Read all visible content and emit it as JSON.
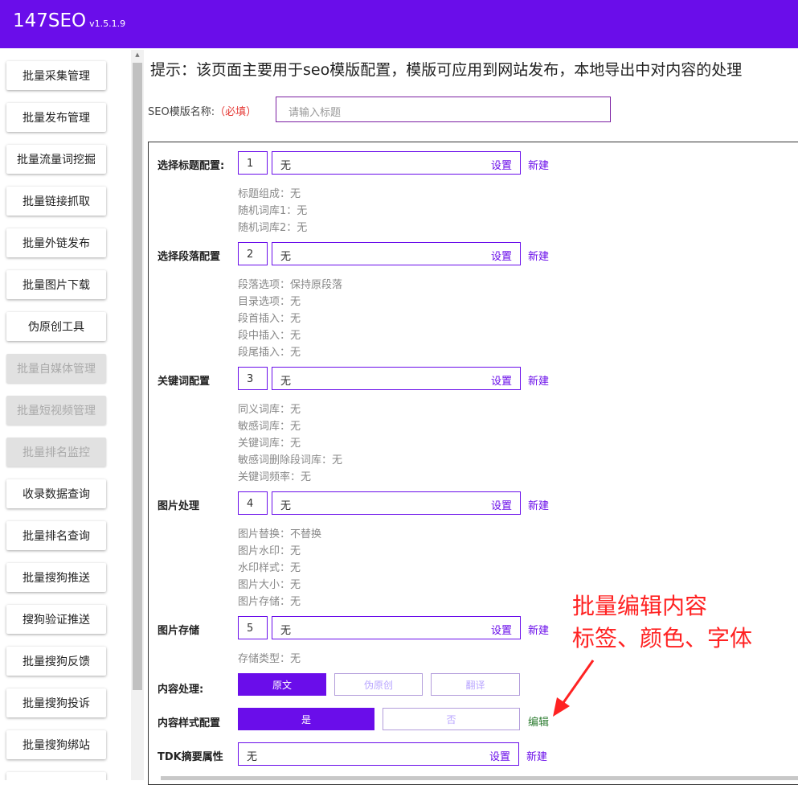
{
  "app": {
    "title": "147SEO",
    "version": "v1.5.1.9"
  },
  "sidebar": {
    "items": [
      {
        "label": "批量采集管理",
        "disabled": false
      },
      {
        "label": "批量发布管理",
        "disabled": false
      },
      {
        "label": "批量流量词挖掘",
        "disabled": false
      },
      {
        "label": "批量链接抓取",
        "disabled": false
      },
      {
        "label": "批量外链发布",
        "disabled": false
      },
      {
        "label": "批量图片下载",
        "disabled": false
      },
      {
        "label": "伪原创工具",
        "disabled": false
      },
      {
        "label": "批量自媒体管理",
        "disabled": true
      },
      {
        "label": "批量短视频管理",
        "disabled": true
      },
      {
        "label": "批量排名监控",
        "disabled": true
      },
      {
        "label": "收录数据查询",
        "disabled": false
      },
      {
        "label": "批量排名查询",
        "disabled": false
      },
      {
        "label": "批量搜狗推送",
        "disabled": false
      },
      {
        "label": "搜狗验证推送",
        "disabled": false
      },
      {
        "label": "批量搜狗反馈",
        "disabled": false
      },
      {
        "label": "批量搜狗投诉",
        "disabled": false
      },
      {
        "label": "批量搜狗绑站",
        "disabled": false
      }
    ]
  },
  "notice": "提示：该页面主要用于seo模版配置，模版可应用到网站发布，本地导出中对内容的处理",
  "template_name": {
    "label": "SEO模版名称:",
    "required": "（必填）",
    "placeholder": "请输入标题"
  },
  "config": {
    "set_label": "设置",
    "new_label": "新建",
    "rows": [
      {
        "label": "选择标题配置:",
        "number": "1",
        "value": "无",
        "details": [
          "标题组成：无",
          "随机词库1：无",
          "随机词库2：无"
        ]
      },
      {
        "label": "选择段落配置",
        "number": "2",
        "value": "无",
        "details": [
          "段落选项：保持原段落",
          "目录选项：无",
          "段首插入：无",
          "段中插入：无",
          "段尾插入：无"
        ]
      },
      {
        "label": "关键词配置",
        "number": "3",
        "value": "无",
        "details": [
          "同义词库：无",
          "敏感词库：无",
          "关键词库：无",
          "敏感词删除段词库：无",
          "关键词频率：无"
        ]
      },
      {
        "label": "图片处理",
        "number": "4",
        "value": "无",
        "details": [
          "图片替换：不替换",
          "图片水印：无",
          "水印样式：无",
          "图片大小：无",
          "图片存储：无"
        ]
      },
      {
        "label": "图片存储",
        "number": "5",
        "value": "无",
        "details": [
          "存储类型：无"
        ]
      }
    ]
  },
  "content_process": {
    "label": "内容处理:",
    "options": [
      "原文",
      "伪原创",
      "翻译"
    ]
  },
  "content_style": {
    "label": "内容样式配置",
    "yes": "是",
    "no": "否",
    "edit": "编辑"
  },
  "tdk": {
    "label": "TDK摘要属性",
    "value": "无",
    "set": "设置",
    "new": "新建"
  },
  "annotation": {
    "line1": "批量编辑内容",
    "line2": "标签、颜色、字体"
  },
  "colors": {
    "brand": "#6a0dea",
    "annotation": "#ff2222",
    "edit_link": "#2e7d32"
  }
}
